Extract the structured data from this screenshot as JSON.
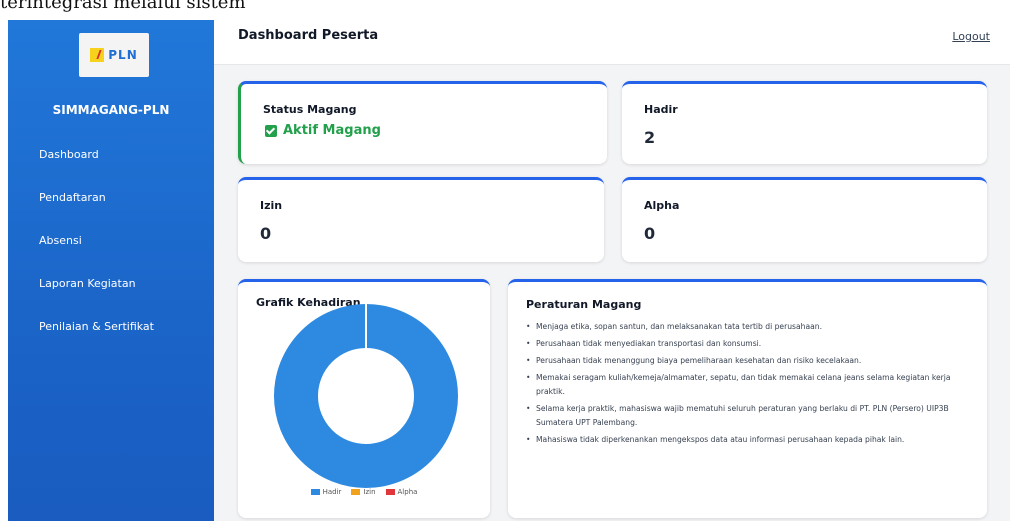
{
  "doc_text": "terintegrasi melalui sistem",
  "sidebar": {
    "logo_text": "PLN",
    "app_name": "SIMMAGANG-PLN",
    "items": [
      {
        "label": "Dashboard"
      },
      {
        "label": "Pendaftaran"
      },
      {
        "label": "Absensi"
      },
      {
        "label": "Laporan Kegiatan"
      },
      {
        "label": "Penilaian & Sertifikat"
      }
    ]
  },
  "header": {
    "title": "Dashboard Peserta",
    "logout_label": "Logout"
  },
  "cards": {
    "status": {
      "title": "Status Magang",
      "value": "Aktif Magang"
    },
    "hadir": {
      "title": "Hadir",
      "value": "2"
    },
    "izin": {
      "title": "Izin",
      "value": "0"
    },
    "alpha": {
      "title": "Alpha",
      "value": "0"
    }
  },
  "chart_card": {
    "title": "Grafik Kehadiran"
  },
  "chart_data": {
    "type": "pie",
    "categories": [
      "Hadir",
      "Izin",
      "Alpha"
    ],
    "values": [
      2,
      0,
      0
    ],
    "colors": [
      "#2d8ae0",
      "#f0a21c",
      "#e1363b"
    ],
    "legend": "bottom"
  },
  "rules": {
    "title": "Peraturan Magang",
    "items": [
      "Menjaga etika, sopan santun, dan melaksanakan tata tertib di perusahaan.",
      "Perusahaan tidak menyediakan transportasi dan konsumsi.",
      "Perusahaan tidak menanggung biaya pemeliharaan kesehatan dan risiko kecelakaan.",
      "Memakai seragam kuliah/kemeja/almamater, sepatu, dan tidak memakai celana jeans selama kegiatan kerja praktik.",
      "Selama kerja praktik, mahasiswa wajib mematuhi seluruh peraturan yang berlaku di PT. PLN (Persero) UIP3B Sumatera UPT Palembang.",
      "Mahasiswa tidak diperkenankan mengekspos data atau informasi perusahaan kepada pihak lain."
    ]
  }
}
